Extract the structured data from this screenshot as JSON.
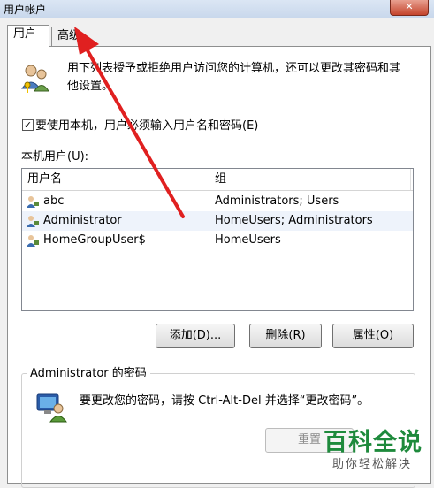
{
  "window": {
    "title": "用户帐户",
    "close_label": "✕"
  },
  "tabs": [
    {
      "label": "用户"
    },
    {
      "label": "高级"
    }
  ],
  "intro_text": "用下列表授予或拒绝用户访问您的计算机，还可以更改其密码和其他设置。",
  "require_login": {
    "label": "要使用本机，用户必须输入用户名和密码(E)",
    "checked": true,
    "check_glyph": "✓"
  },
  "users_list": {
    "label": "本机用户(U):",
    "columns": [
      "用户名",
      "组"
    ],
    "rows": [
      {
        "name": "abc",
        "group": "Administrators; Users",
        "selected": false
      },
      {
        "name": "Administrator",
        "group": "HomeUsers; Administrators",
        "selected": true
      },
      {
        "name": "HomeGroupUser$",
        "group": "HomeUsers",
        "selected": false
      }
    ]
  },
  "buttons": {
    "add": "添加(D)...",
    "delete": "删除(R)",
    "properties": "属性(O)"
  },
  "password_group": {
    "title": "Administrator 的密码",
    "text": "要更改您的密码，请按 Ctrl-Alt-Del 并选择“更改密码”。",
    "reset_label": "重置"
  },
  "watermark": {
    "title": "百科全说",
    "subtitle": "助你轻松解决"
  },
  "colors": {
    "annotation_arrow": "#e02020",
    "watermark_green": "#1e8a3c",
    "selection": "#eef3fb"
  }
}
